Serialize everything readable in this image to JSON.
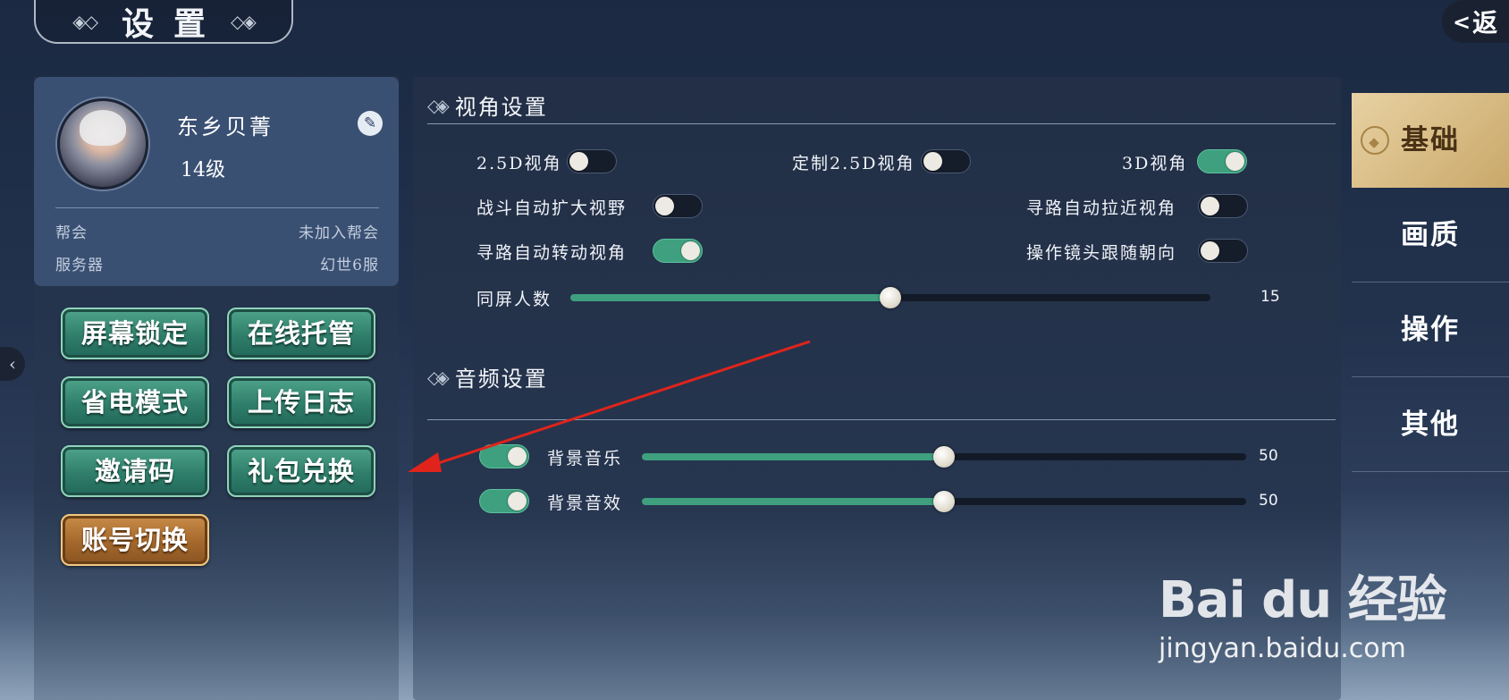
{
  "header": {
    "title": "设置",
    "back_label": "返"
  },
  "profile": {
    "name": "东乡贝菁",
    "level": "14级",
    "guild_label": "帮会",
    "guild_value": "未加入帮会",
    "server_label": "服务器",
    "server_value": "幻世6服"
  },
  "actions": {
    "screen_lock": "屏幕锁定",
    "online_hosting": "在线托管",
    "power_save": "省电模式",
    "upload_log": "上传日志",
    "invite_code": "邀请码",
    "gift_redeem": "礼包兑换",
    "switch_account": "账号切换"
  },
  "view_settings": {
    "title": "视角设置",
    "options": [
      {
        "label": "2.5D视角",
        "on": false
      },
      {
        "label": "定制2.5D视角",
        "on": false
      },
      {
        "label": "3D视角",
        "on": true
      },
      {
        "label": "战斗自动扩大视野",
        "on": false
      },
      {
        "label": "寻路自动拉近视角",
        "on": false
      },
      {
        "label": "寻路自动转动视角",
        "on": true
      },
      {
        "label": "操作镜头跟随朝向",
        "on": false
      }
    ],
    "players_on_screen": {
      "label": "同屏人数",
      "value": "15",
      "fraction": 0.5
    }
  },
  "audio_settings": {
    "title": "音频设置",
    "bgm": {
      "label": "背景音乐",
      "value": "50",
      "fraction": 0.5,
      "on": true
    },
    "sfx": {
      "label": "背景音效",
      "value": "50",
      "fraction": 0.5,
      "on": true
    }
  },
  "tabs": [
    {
      "label": "基础",
      "active": true
    },
    {
      "label": "画质",
      "active": false
    },
    {
      "label": "操作",
      "active": false
    },
    {
      "label": "其他",
      "active": false
    }
  ],
  "watermark": {
    "brand": "Bai du 经验",
    "url": "jingyan.baidu.com"
  },
  "colors": {
    "accent_green": "#3fa07f",
    "active_tab_gold": "#d9bd86",
    "annotation_red": "#e0241b"
  }
}
